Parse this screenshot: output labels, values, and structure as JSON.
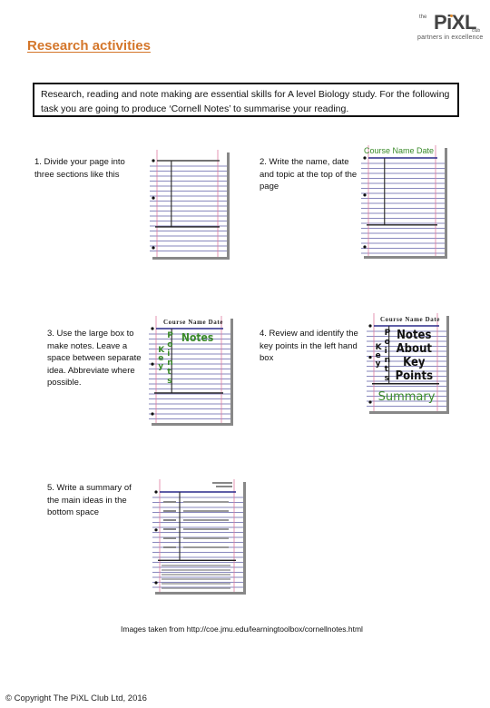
{
  "header": {
    "logo": {
      "the": "the",
      "brand": "PiXL",
      "club": "club",
      "tagline": "partners in excellence"
    },
    "title": "Research activities"
  },
  "intro": "Research, reading and note making are essential skills for A level Biology study. For the following task you are going to produce ‘Cornell Notes’ to summarise your reading.",
  "steps": [
    {
      "text": "1. Divide your page into three sections like this"
    },
    {
      "text": "2. Write the name, date and topic at the top of the page",
      "image_heading": "Course Name Date"
    },
    {
      "text": "3. Use the large box to make notes. Leave a space between separate idea. Abbreviate where possible.",
      "image_heading": "Course Name Date",
      "cue_label": "Key Points",
      "notes_label": "Notes"
    },
    {
      "text": "4. Review and identify the key points in the left hand box",
      "image_heading": "Course Name Date",
      "cue_label": "Key Points",
      "notes_label": "Notes About Key Points",
      "summary_label": "Summary"
    },
    {
      "text": "5. Write a summary of the main ideas in the bottom space"
    }
  ],
  "colors": {
    "title": "#d4762a",
    "rule": "#2a2a8a",
    "margin": "#e07aa0",
    "green": "#3a8a2a"
  },
  "credit": "Images taken from http://coe.jmu.edu/learningtoolbox/cornellnotes.html",
  "footer": {
    "copyright": "© Copyright The PiXL Club Ltd, 2016"
  }
}
